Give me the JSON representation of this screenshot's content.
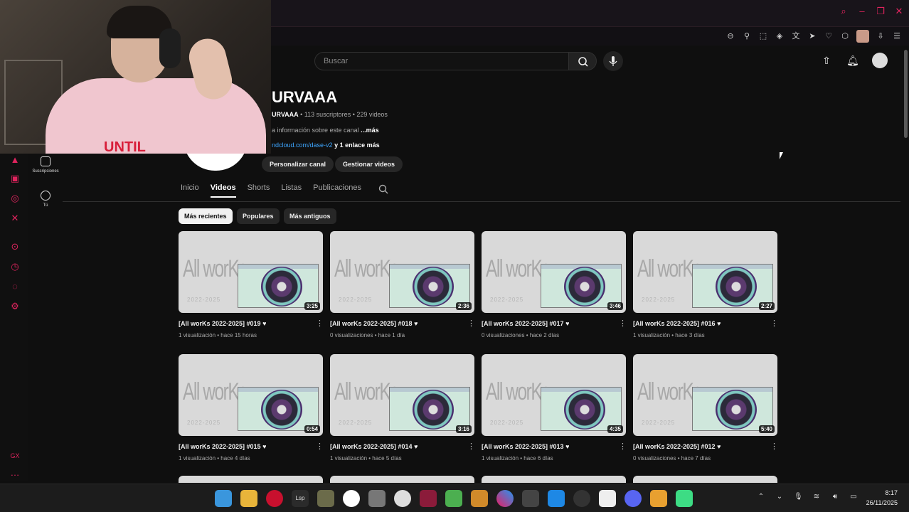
{
  "header": {
    "search_placeholder": "Buscar"
  },
  "channel": {
    "name": "URVAAA",
    "handle": "URVAAA",
    "meta_rest": " • 113 suscriptores • 229 videos",
    "desc": "a información sobre este canal",
    "desc_more": "...más",
    "link": "ndcloud.com/dase-v2",
    "link_more": "y 1 enlace más",
    "btn_customize": "Personalizar canal",
    "btn_manage": "Gestionar videos"
  },
  "guide": {
    "subs": "Suscripciones",
    "you": "Tú"
  },
  "tabs": [
    "Inicio",
    "Videos",
    "Shorts",
    "Listas",
    "Publicaciones"
  ],
  "chips": [
    "Más recientes",
    "Populares",
    "Más antiguos"
  ],
  "thumb_text": {
    "big": "All worKs",
    "years": "2022-2025"
  },
  "videos": [
    {
      "title": "[All worKs 2022-2025] #019 ♥",
      "meta": "1 visualización • hace 15 horas",
      "duration": "3:25"
    },
    {
      "title": "[All worKs 2022-2025] #018 ♥",
      "meta": "0 visualizaciones • hace 1 día",
      "duration": "2:36"
    },
    {
      "title": "[All worKs 2022-2025] #017 ♥",
      "meta": "0 visualizaciones • hace 2 días",
      "duration": "3:46"
    },
    {
      "title": "[All worKs 2022-2025] #016 ♥",
      "meta": "1 visualización • hace 3 días",
      "duration": "2:27"
    },
    {
      "title": "[All worKs 2022-2025] #015 ♥",
      "meta": "1 visualización • hace 4 días",
      "duration": "0:54"
    },
    {
      "title": "[All worKs 2022-2025] #014 ♥",
      "meta": "1 visualización • hace 5 días",
      "duration": "3:16"
    },
    {
      "title": "[All worKs 2022-2025] #013 ♥",
      "meta": "1 visualización • hace 6 días",
      "duration": "4:35"
    },
    {
      "title": "[All worKs 2022-2025] #012 ♥",
      "meta": "0 visualizaciones • hace 7 días",
      "duration": "5:40"
    }
  ],
  "webcam": {
    "shirt_text": "UNTIL"
  },
  "taskbar": {
    "time": "8:17",
    "date": "26/11/2025"
  },
  "colors": {
    "accent": "#e0245e",
    "background": "#0f0f0f"
  }
}
